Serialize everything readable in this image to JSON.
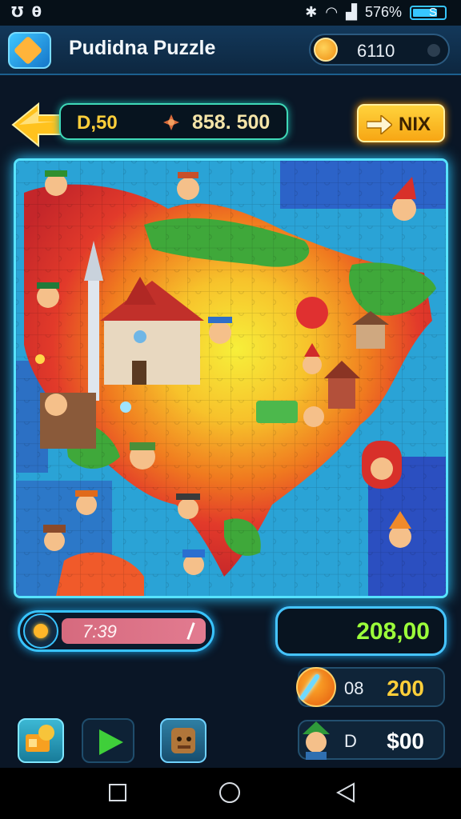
{
  "status_bar": {
    "left_icons": "Ʊ θ",
    "battery": "576%",
    "battery_suffix": "S",
    "icons": [
      "bluetooth-icon",
      "wifi-icon",
      "signal-icon",
      "battery-icon"
    ]
  },
  "header": {
    "title": "Pudidna Puzzle",
    "coins": "6110"
  },
  "score_bar": {
    "left_value": "D,50",
    "right_value": "858. 500"
  },
  "nix_button": {
    "label": "NIX"
  },
  "timer": {
    "time": "7:39"
  },
  "points": {
    "value": "208,00"
  },
  "bonus": {
    "label": "08",
    "value": "200",
    "value_color": "#ffcf3a"
  },
  "cash": {
    "label": "D",
    "value": "$00",
    "value_color": "#ffffff"
  },
  "colors": {
    "accent_glow": "#57e3ff",
    "points_green": "#9cff3a",
    "score_gold": "#ffcf3a"
  }
}
